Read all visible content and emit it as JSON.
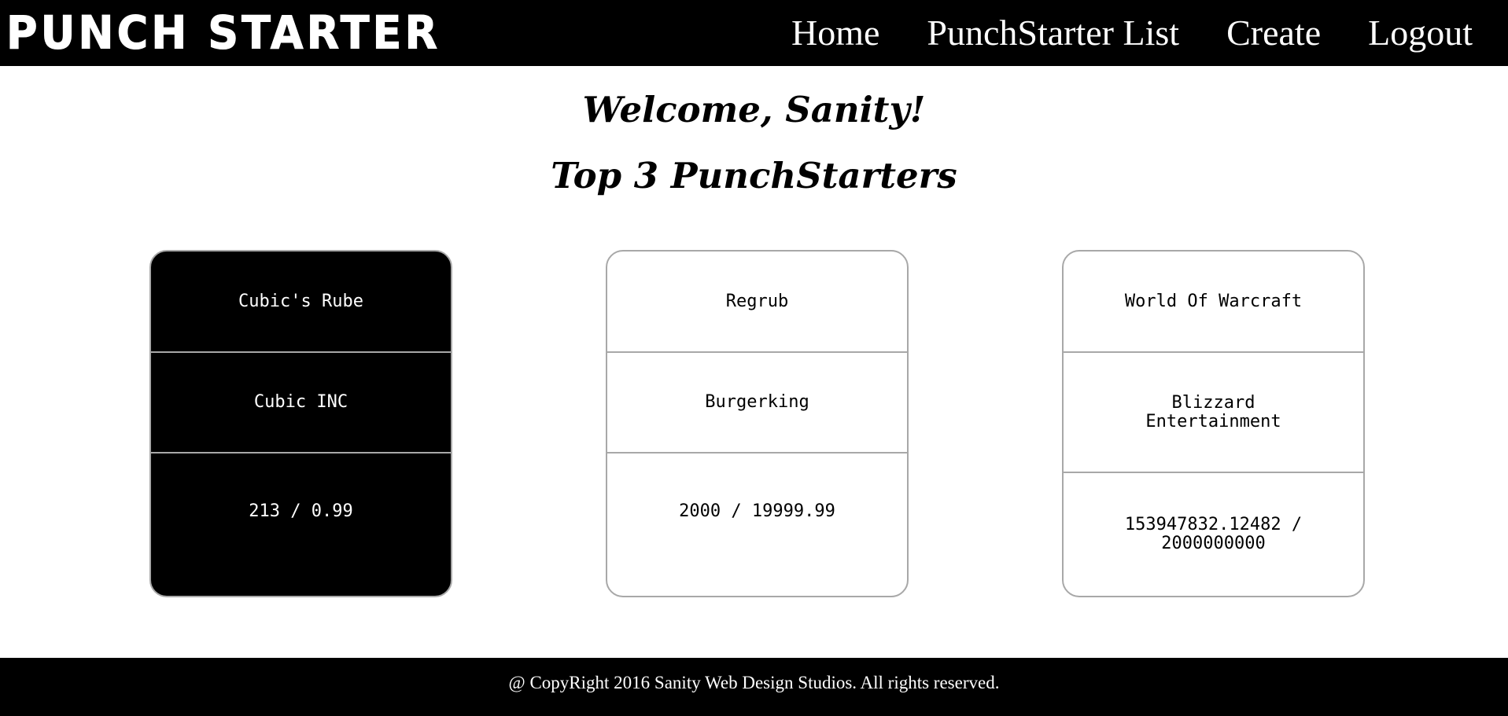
{
  "header": {
    "logo": "PUNCH STARTER",
    "nav": [
      "Home",
      "PunchStarter List",
      "Create",
      "Logout"
    ]
  },
  "main": {
    "welcome": "Welcome, Sanity!",
    "subtitle": "Top 3 PunchStarters"
  },
  "cards": [
    {
      "name": "Cubic's Rube",
      "company": "Cubic INC",
      "funding": "213 / 0.99",
      "theme": "dark"
    },
    {
      "name": "Regrub",
      "company": "Burgerking",
      "funding": "2000 / 19999.99",
      "theme": "light"
    },
    {
      "name": "World Of Warcraft",
      "company": "Blizzard Entertainment",
      "funding": "153947832.12482 / 2000000000",
      "theme": "light"
    }
  ],
  "footer": {
    "text": "@ CopyRight 2016 Sanity Web Design Studios. All rights reserved."
  },
  "colors": {
    "header_bg": "#000000",
    "page_bg": "#ffffff",
    "card_border": "#a8a8a8"
  }
}
